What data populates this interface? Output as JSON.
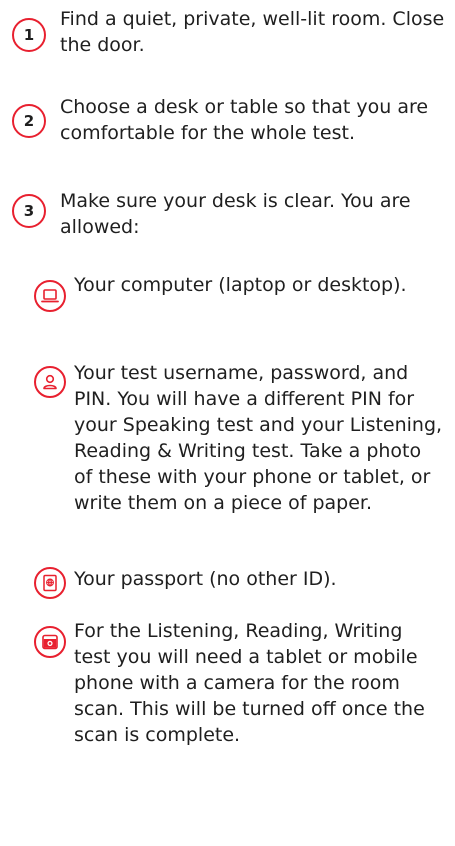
{
  "steps": [
    {
      "number": "1",
      "text": "Find a quiet, private, well-lit room. Close the door."
    },
    {
      "number": "2",
      "text": "Choose a desk or table so that you are comfortable for the whole test."
    },
    {
      "number": "3",
      "text": "Make sure your desk is clear. You are allowed:"
    }
  ],
  "allowed_items": [
    {
      "icon": "laptop-icon",
      "text": "Your computer (laptop or desktop)."
    },
    {
      "icon": "person-icon",
      "text": "Your test username, password, and PIN. You will have a different PIN for your Speaking test and your Listening, Reading & Writing test. Take a photo of these with your phone or tablet, or write them on a piece of paper."
    },
    {
      "icon": "passport-icon",
      "text": "Your passport (no other ID)."
    },
    {
      "icon": "camera-phone-icon",
      "text": "For the Listening, Reading, Writing test you will need a tablet or mobile phone with a camera for the room scan. This will be turned off once the scan is complete."
    }
  ],
  "colors": {
    "accent": "#e8202f",
    "text": "#1f1f1f"
  }
}
